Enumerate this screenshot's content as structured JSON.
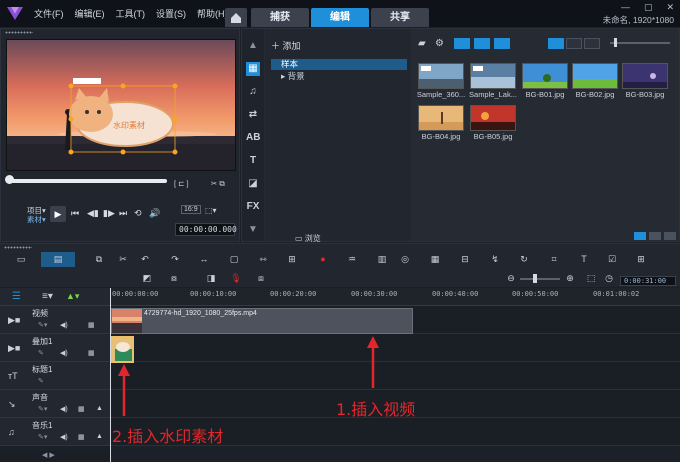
{
  "menu": {
    "items": [
      "文件(F)",
      "编辑(E)",
      "工具(T)",
      "设置(S)",
      "帮助(H)"
    ]
  },
  "tabs": [
    {
      "label": "捕获",
      "active": false
    },
    {
      "label": "编辑",
      "active": true
    },
    {
      "label": "共享",
      "active": false
    }
  ],
  "project_info": "未命名, 1920*1080",
  "preview": {
    "watermark_text": "水印素材",
    "label_project": "项目▾",
    "label_clip": "素材▾",
    "aspect": "16:9",
    "timecode": "00:00:00.000"
  },
  "library": {
    "add_label": "添加",
    "folders": [
      "样本",
      "背景"
    ],
    "browse_label": "浏览",
    "thumbnails": [
      {
        "label": "Sample_360..."
      },
      {
        "label": "Sample_Lak..."
      },
      {
        "label": "BG-B01.jpg"
      },
      {
        "label": "BG-B02.jpg"
      },
      {
        "label": "BG-B03.jpg"
      },
      {
        "label": "BG-B04.jpg"
      },
      {
        "label": "BG-B05.jpg"
      }
    ]
  },
  "toolbar": {
    "zoom_time": "0:00:31:00"
  },
  "timeline": {
    "ruler_ticks": [
      "00:00:00:00",
      "00:00:10:00",
      "00:00:20:00",
      "00:00:30:00",
      "00:00:40:00",
      "00:00:50:00",
      "00:01:00:02"
    ],
    "tracks": [
      {
        "name": "视频"
      },
      {
        "name": "叠加1"
      },
      {
        "name": "标题1"
      },
      {
        "name": "声音"
      },
      {
        "name": "音乐1"
      }
    ],
    "video_clip_name": "4729774-hd_1920_1080_25fps.mp4"
  },
  "annotations": {
    "insert_video": "1.插入视频",
    "insert_watermark": "2.插入水印素材"
  },
  "colors": {
    "accent": "#1e8fd8",
    "annotation": "#e3262b"
  }
}
